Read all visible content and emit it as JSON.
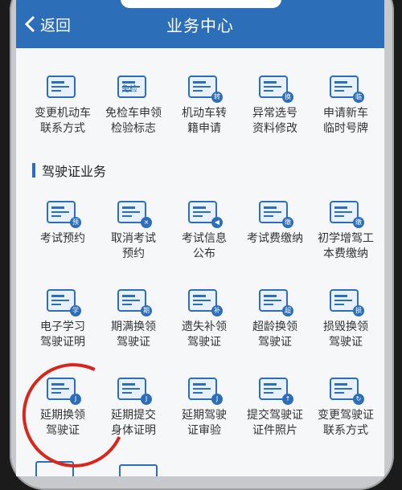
{
  "header": {
    "back_label": "返回",
    "title": "业务中心"
  },
  "top_row": [
    {
      "label": [
        "变更机动车",
        "联系方式"
      ],
      "icon": "vehicle-contact-icon"
    },
    {
      "label": [
        "免检车申领",
        "检验标志"
      ],
      "icon": "exempt-check-icon",
      "icon_text": "免检"
    },
    {
      "label": [
        "机动车转",
        "籍申请"
      ],
      "icon": "vehicle-transfer-icon",
      "badge": "转"
    },
    {
      "label": [
        "异常选号",
        "资料修改"
      ],
      "icon": "plate-number-icon",
      "badge": "换"
    },
    {
      "label": [
        "申请新车",
        "临时号牌"
      ],
      "icon": "temp-plate-icon",
      "badge": "临"
    }
  ],
  "section": {
    "title": "驾驶证业务"
  },
  "rows": [
    [
      {
        "label": [
          "考试预约"
        ],
        "icon": "exam-booking-icon",
        "badge": "预"
      },
      {
        "label": [
          "取消考试",
          "预约"
        ],
        "icon": "cancel-exam-icon",
        "badge": "×"
      },
      {
        "label": [
          "考试信息",
          "公布"
        ],
        "icon": "exam-info-icon",
        "badge": "◀"
      },
      {
        "label": [
          "考试费缴纳"
        ],
        "icon": "exam-fee-icon",
        "badge": "缴"
      },
      {
        "label": [
          "初学增驾工",
          "本费缴纳"
        ],
        "icon": "learner-fee-icon",
        "badge": "缴"
      }
    ],
    [
      {
        "label": [
          "电子学习",
          "驾驶证明"
        ],
        "icon": "learning-certificate-icon",
        "badge": "学"
      },
      {
        "label": [
          "期满换领",
          "驾驶证"
        ],
        "icon": "expiry-renew-icon",
        "badge": "期"
      },
      {
        "label": [
          "遗失补领",
          "驾驶证"
        ],
        "icon": "lost-replace-icon",
        "badge": "补"
      },
      {
        "label": [
          "超龄换领",
          "驾驶证"
        ],
        "icon": "overage-renew-icon",
        "badge": "超"
      },
      {
        "label": [
          "损毁换领",
          "驾驶证"
        ],
        "icon": "damaged-renew-icon",
        "badge": "损"
      }
    ],
    [
      {
        "label": [
          "延期换领",
          "驾驶证"
        ],
        "icon": "deferred-renew-icon",
        "badge": "J"
      },
      {
        "label": [
          "延期提交",
          "身体证明"
        ],
        "icon": "health-certificate-icon",
        "badge": "J"
      },
      {
        "label": [
          "延期驾驶",
          "证审验"
        ],
        "icon": "deferred-review-icon",
        "badge": "J"
      },
      {
        "label": [
          "提交驾驶证",
          "证件照片"
        ],
        "icon": "id-photo-icon",
        "badge": "↑"
      },
      {
        "label": [
          "变更驾驶证",
          "联系方式"
        ],
        "icon": "license-contact-icon",
        "badge": "↻"
      }
    ]
  ],
  "colors": {
    "accent": "#2c6fb8",
    "highlight": "#d9261c"
  }
}
